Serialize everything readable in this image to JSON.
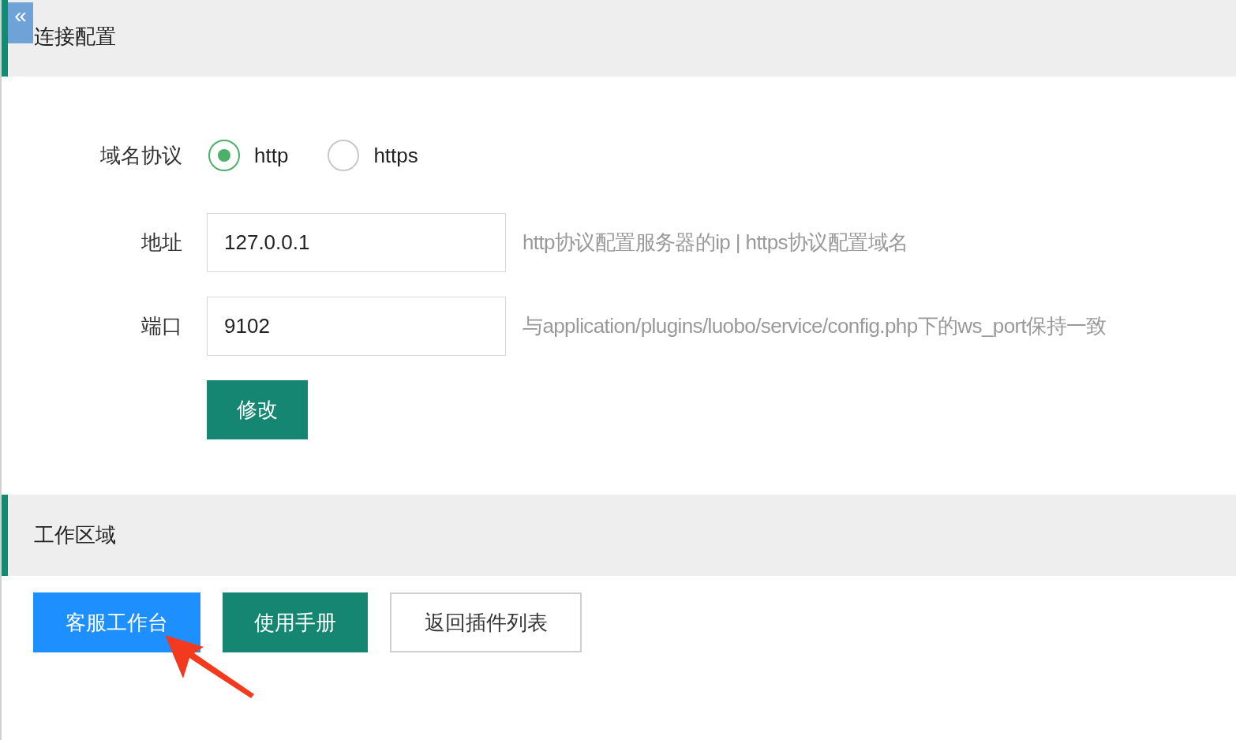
{
  "collapse_button": {
    "label": "«"
  },
  "connection_section": {
    "title": "连接配置",
    "protocol": {
      "label": "域名协议",
      "options": [
        {
          "label": "http",
          "selected": true
        },
        {
          "label": "https",
          "selected": false
        }
      ]
    },
    "fields": [
      {
        "label": "地址",
        "value": "127.0.0.1",
        "hint": "http协议配置服务器的ip | https协议配置域名"
      },
      {
        "label": "端口",
        "value": "9102",
        "hint": "与application/plugins/luobo/service/config.php下的ws_port保持一致"
      }
    ],
    "submit": "修改"
  },
  "work_section": {
    "title": "工作区域",
    "buttons": [
      {
        "label": "客服工作台",
        "kind": "primary"
      },
      {
        "label": "使用手册",
        "kind": "success"
      },
      {
        "label": "返回插件列表",
        "kind": "plain"
      }
    ]
  }
}
